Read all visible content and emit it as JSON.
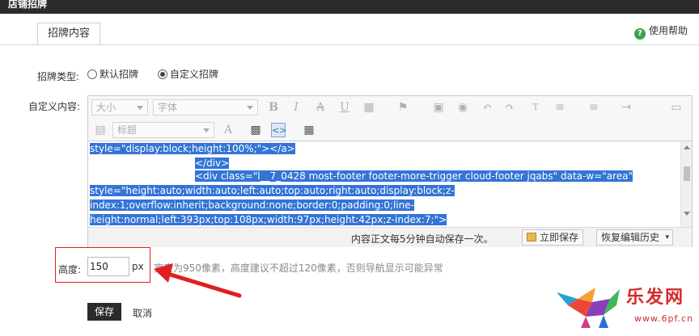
{
  "header": {
    "title": "店铺招牌"
  },
  "tabs": [
    {
      "label": "招牌内容"
    }
  ],
  "help": {
    "label": "使用帮助"
  },
  "form": {
    "type_label": "招牌类型:",
    "type_options": [
      {
        "label": "默认招牌",
        "selected": false
      },
      {
        "label": "自定义招牌",
        "selected": true
      }
    ],
    "content_label": "自定义内容:",
    "height_label": "高度:",
    "height_value": "150",
    "height_unit": "px",
    "height_hint": "宽度为950像素，高度建议不超过120像素，否则导航显示可能异常"
  },
  "editor": {
    "font_size_placeholder": "大小",
    "font_family_placeholder": "字体",
    "heading_placeholder": "标题",
    "code_lines": [
      "style=\"display:block;height:100%;\"></a>",
      "</div>",
      "<div class=\"l__7_0428 most-footer footer-more-trigger cloud-footer jqabs\" data-w=\"area\"",
      "style=\"height:auto;width:auto;left:auto;top:auto;right:auto;display:block;z-",
      "index:1;overflow:inherit;background:none;border:0;padding:0;line-",
      "height:normal;left:393px;top:108px;width:97px;height:42px;z-index:7;\">"
    ],
    "autosave_msg": "内容正文每5分钟自动保存一次。",
    "save_now_label": "立即保存",
    "restore_label": "恢复编辑历史"
  },
  "actions": {
    "save_label": "保存",
    "cancel_label": "取消"
  },
  "watermark": {
    "brand": "乐发网",
    "url": "www.6pf.cn"
  },
  "colors": {
    "header_bg": "#2b2b2b",
    "selection": "#3374d6",
    "highlight_box": "#e02020",
    "save_bg": "#2b2b2b"
  }
}
